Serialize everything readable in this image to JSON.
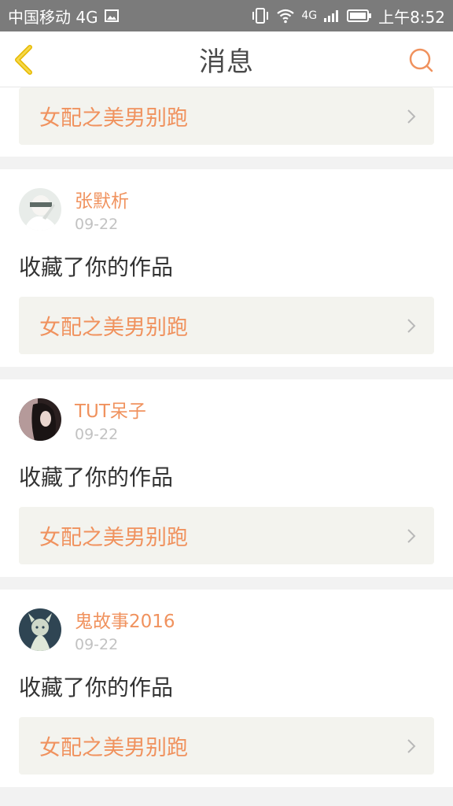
{
  "status_bar": {
    "carrier": "中国移动 4G",
    "network": "4G",
    "time": "上午8:52"
  },
  "nav": {
    "title": "消息",
    "back_icon": "chevron-left-icon",
    "search_icon": "search-icon"
  },
  "colors": {
    "accent": "#f0925e",
    "back_arrow": "#f5c518",
    "work_box_bg": "#f3f3ee",
    "divider": "#f2f2f2",
    "status_bar_bg": "#7b7b7b"
  },
  "partial_item": {
    "work_title": "女配之美男别跑"
  },
  "messages": [
    {
      "username": "张默析",
      "date": "09-22",
      "action": "收藏了你的作品",
      "work_title": "女配之美男别跑",
      "avatar_icon": "avatar-white-figure"
    },
    {
      "username": "TUT呆子",
      "date": "09-22",
      "action": "收藏了你的作品",
      "work_title": "女配之美男别跑",
      "avatar_icon": "avatar-dark-hair"
    },
    {
      "username": "鬼故事2016",
      "date": "09-22",
      "action": "收藏了你的作品",
      "work_title": "女配之美男别跑",
      "avatar_icon": "avatar-ghost-illustration"
    }
  ]
}
